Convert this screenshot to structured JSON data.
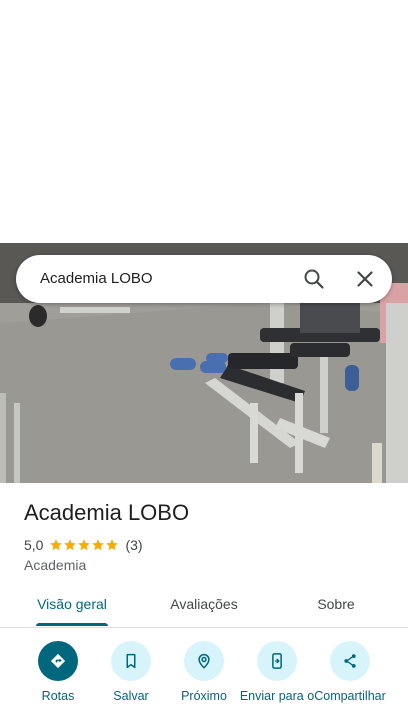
{
  "search": {
    "query": "Academia LOBO"
  },
  "place": {
    "name": "Academia LOBO",
    "rating": "5,0",
    "rating_value": 5,
    "review_count": "(3)",
    "category": "Academia"
  },
  "tabs": [
    {
      "label": "Visão geral",
      "active": true
    },
    {
      "label": "Avaliações",
      "active": false
    },
    {
      "label": "Sobre",
      "active": false
    }
  ],
  "actions": [
    {
      "label": "Rotas",
      "icon": "directions-icon"
    },
    {
      "label": "Salvar",
      "icon": "bookmark-icon"
    },
    {
      "label": "Próximo",
      "icon": "nearby-icon"
    },
    {
      "label": "Enviar para o",
      "icon": "send-to-phone-icon"
    },
    {
      "label": "Compartilhar",
      "icon": "share-icon"
    }
  ],
  "colors": {
    "accent": "#00677d",
    "action_bg": "#d8f4fb",
    "star": "#f9ab00",
    "text_primary": "#1f1f1f"
  }
}
